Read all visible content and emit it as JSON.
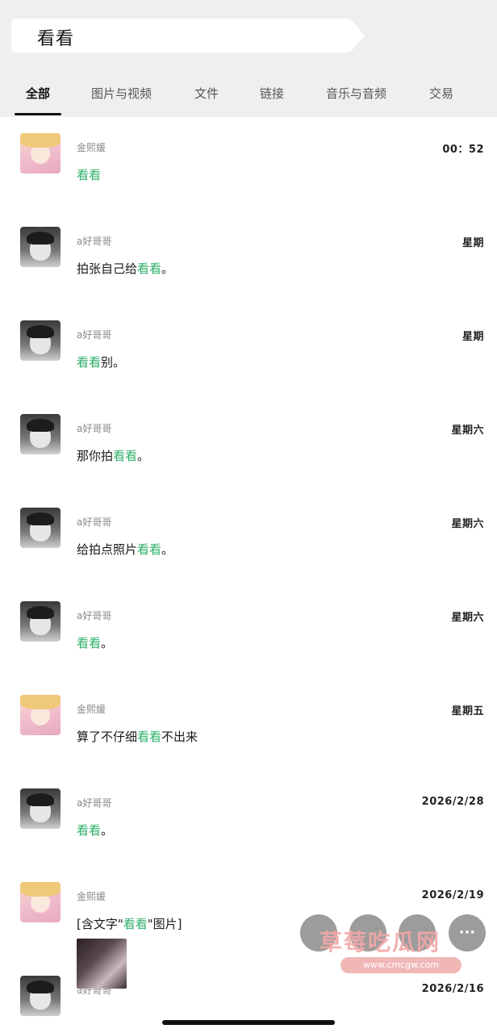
{
  "search": {
    "query": "看看"
  },
  "tabs": [
    {
      "label": "全部"
    },
    {
      "label": "图片与视频"
    },
    {
      "label": "文件"
    },
    {
      "label": "链接"
    },
    {
      "label": "音乐与音频"
    },
    {
      "label": "交易"
    }
  ],
  "messages": [
    {
      "avatar": "girl-avatar",
      "sender": "金熙媛",
      "time": "00：52",
      "pre": "",
      "hl": "看看",
      "post": ""
    },
    {
      "avatar": "boy-avatar",
      "sender": "a好哥哥",
      "time": "星期",
      "pre": "拍张自己给",
      "hl": "看看",
      "post": "。"
    },
    {
      "avatar": "boy-avatar",
      "sender": "a好哥哥",
      "time": "星期",
      "pre": "",
      "hl": "看看",
      "post": "别。"
    },
    {
      "avatar": "boy-avatar",
      "sender": "a好哥哥",
      "time": "星期六",
      "pre": "那你拍",
      "hl": "看看",
      "post": "。"
    },
    {
      "avatar": "boy-avatar",
      "sender": "a好哥哥",
      "time": "星期六",
      "pre": "给拍点照片",
      "hl": "看看",
      "post": "。"
    },
    {
      "avatar": "boy-avatar",
      "sender": "a好哥哥",
      "time": "星期六",
      "pre": "",
      "hl": "看看",
      "post": "。"
    },
    {
      "avatar": "girl-avatar",
      "sender": "金熙媛",
      "time": "星期五",
      "pre": "算了不仔细",
      "hl": "看看",
      "post": "不出来"
    },
    {
      "avatar": "boy-avatar",
      "sender": "a好哥哥",
      "time": "2026/2/28",
      "pre": "",
      "hl": "看看",
      "post": "。"
    },
    {
      "avatar": "girl-avatar",
      "sender": "金熙媛",
      "time": "2026/2/19",
      "pre": "[含文字\"",
      "hl": "看看",
      "post": "\"图片]"
    },
    {
      "avatar": "boy-avatar",
      "sender": "a好哥哥",
      "time": "2026/2/16",
      "pre": "",
      "hl": "",
      "post": ""
    }
  ],
  "overlay": {
    "fab_label": "···",
    "watermark": "草莓吃瓜网",
    "watermark_url": "www.cmcgw.com"
  },
  "colors": {
    "highlight": "#2bae67",
    "header_bg": "#efefef"
  }
}
